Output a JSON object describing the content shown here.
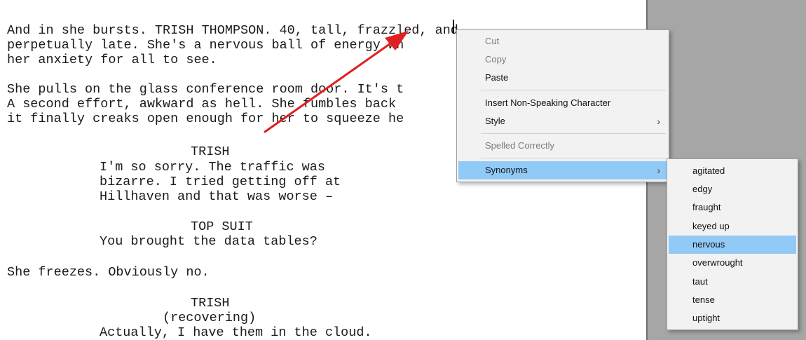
{
  "script": {
    "lines": [
      "And in she bursts. TRISH THOMPSON. 40, tall, frazzled, and",
      "perpetually late. She's a nervous ball of energy wh",
      "her anxiety for all to see.",
      "She pulls on the glass conference room door. It's t",
      "A second effort, awkward as hell. She fumbles back",
      "it finally creaks open enough for her to squeeze he",
      "TRISH",
      "I'm so sorry. The traffic was",
      "bizarre. I tried getting off at",
      "Hillhaven and that was worse –",
      "TOP SUIT",
      "You brought the data tables?",
      "She freezes. Obviously no.",
      "TRISH",
      "(recovering)",
      "Actually, I have them in the cloud."
    ]
  },
  "context_menu": {
    "cut": "Cut",
    "copy": "Copy",
    "paste": "Paste",
    "insert_non_speaking": "Insert Non-Speaking Character",
    "style": "Style",
    "spelled_correctly": "Spelled Correctly",
    "synonyms": "Synonyms",
    "submenu_arrow": "›"
  },
  "synonyms": [
    "agitated",
    "edgy",
    "fraught",
    "keyed up",
    "nervous",
    "overwrought",
    "taut",
    "tense",
    "uptight"
  ],
  "colors": {
    "highlight": "#91c9f7",
    "annotation_arrow": "#e02020",
    "gutter": "#a6a6a6"
  }
}
